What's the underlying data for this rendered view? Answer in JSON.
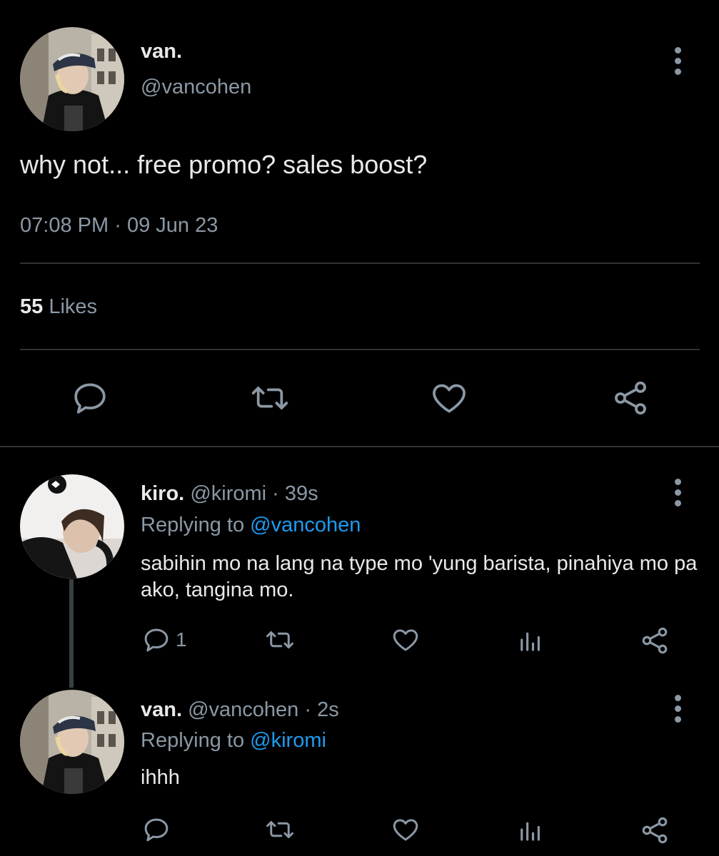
{
  "main_tweet": {
    "display_name": "van.",
    "handle": "@vancohen",
    "text": "why not... free promo? sales boost?",
    "time": "07:08 PM",
    "sep": "·",
    "date": "09 Jun 23",
    "likes_count": "55",
    "likes_label": "Likes"
  },
  "replies": [
    {
      "display_name": "kiro.",
      "handle": "@kiromi",
      "sep": "·",
      "time": "39s",
      "replying_prefix": "Replying to",
      "replying_to": "@vancohen",
      "text": "sabihin mo na lang na type mo 'yung barista, pinahiya mo pa ako, tangina mo.",
      "reply_count": "1"
    },
    {
      "display_name": "van.",
      "handle": "@vancohen",
      "sep": "·",
      "time": "2s",
      "replying_prefix": "Replying to",
      "replying_to": "@kiromi",
      "text": "ihhh",
      "reply_count": ""
    }
  ],
  "icons": {
    "more": "more-vertical-icon",
    "reply": "reply-icon",
    "retweet": "retweet-icon",
    "like": "heart-icon",
    "views": "views-icon",
    "share": "share-icon"
  },
  "colors": {
    "background": "#000000",
    "text": "#e7e9ea",
    "muted": "#8b98a5",
    "link": "#1d9bf0",
    "divider": "#2f3336"
  }
}
